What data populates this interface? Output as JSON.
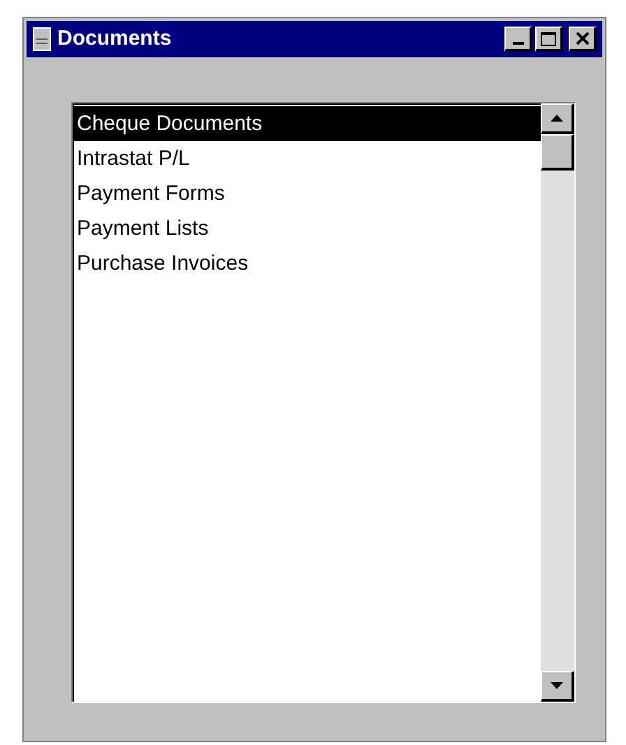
{
  "window": {
    "title": "Documents"
  },
  "list": {
    "items": [
      {
        "label": "Cheque Documents",
        "selected": true
      },
      {
        "label": "Intrastat P/L",
        "selected": false
      },
      {
        "label": "Payment Forms",
        "selected": false
      },
      {
        "label": "Payment Lists",
        "selected": false
      },
      {
        "label": "Purchase Invoices",
        "selected": false
      }
    ]
  }
}
